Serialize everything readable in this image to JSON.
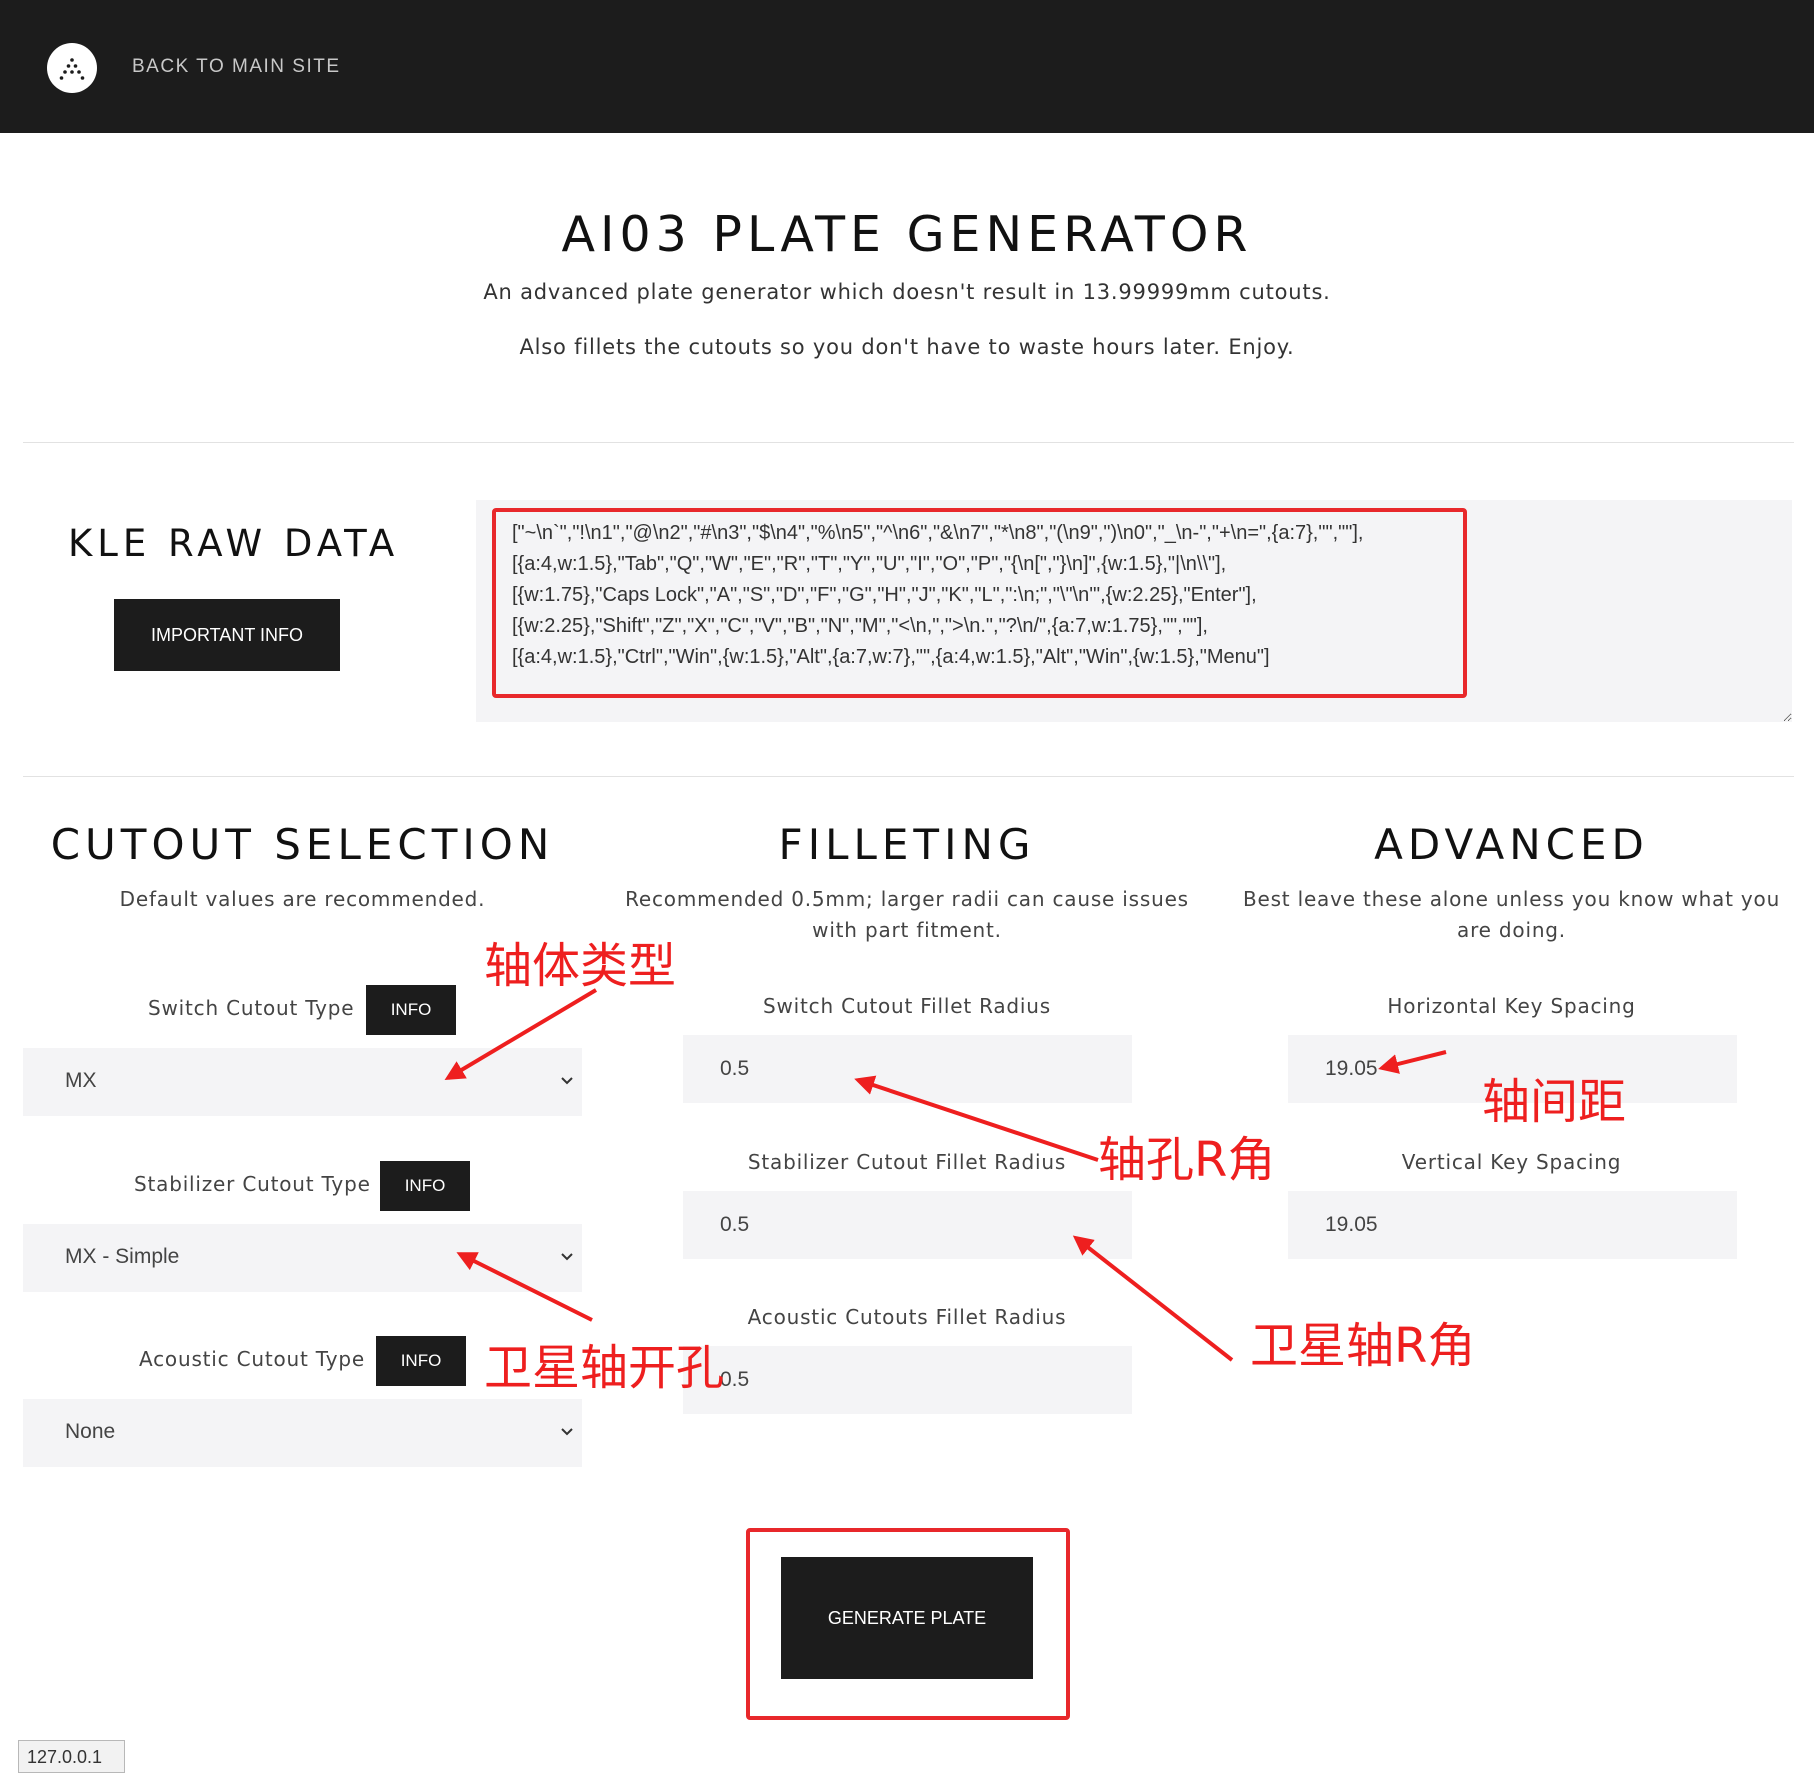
{
  "topbar": {
    "logo_icon": "triangle-dots-logo-icon",
    "back_link": "BACK TO MAIN SITE"
  },
  "hero": {
    "title": "AI03 PLATE GENERATOR",
    "subtitle_1": "An advanced plate generator which doesn't result in 13.99999mm cutouts.",
    "subtitle_2": "Also fillets the cutouts so you don't have to waste hours later. Enjoy."
  },
  "kle": {
    "heading": "KLE RAW DATA",
    "info_button": "IMPORTANT INFO",
    "raw_data": "[\"~\\n`\",\"!\\n1\",\"@\\n2\",\"#\\n3\",\"$\\n4\",\"%\\n5\",\"^\\n6\",\"&\\n7\",\"*\\n8\",\"(\\n9\",\")\\n0\",\"_\\n-\",\"+\\n=\",{a:7},\"\",\"\"],\n[{a:4,w:1.5},\"Tab\",\"Q\",\"W\",\"E\",\"R\",\"T\",\"Y\",\"U\",\"I\",\"O\",\"P\",\"{\\n[\",\"}\\n]\",{w:1.5},\"|\\n\\\\\"],\n[{w:1.75},\"Caps Lock\",\"A\",\"S\",\"D\",\"F\",\"G\",\"H\",\"J\",\"K\",\"L\",\":\\n;\",\"\\\"\\n'\",{w:2.25},\"Enter\"],\n[{w:2.25},\"Shift\",\"Z\",\"X\",\"C\",\"V\",\"B\",\"N\",\"M\",\"<\\n,\",\">\\n.\",\"?\\n/\",{a:7,w:1.75},\"\",\"\"],\n[{a:4,w:1.5},\"Ctrl\",\"Win\",{w:1.5},\"Alt\",{a:7,w:7},\"\",{a:4,w:1.5},\"Alt\",\"Win\",{w:1.5},\"Menu\"]"
  },
  "cutout": {
    "heading": "CUTOUT SELECTION",
    "description": "Default values are recommended.",
    "switch_label": "Switch Cutout Type",
    "switch_value": "MX",
    "stab_label": "Stabilizer Cutout Type",
    "stab_value": "MX - Simple",
    "acoustic_label": "Acoustic Cutout Type",
    "acoustic_value": "None",
    "info_button": "INFO"
  },
  "filleting": {
    "heading": "FILLETING",
    "description": "Recommended 0.5mm; larger radii can cause issues with part fitment.",
    "switch_label": "Switch Cutout Fillet Radius",
    "switch_value": "0.5",
    "stab_label": "Stabilizer Cutout Fillet Radius",
    "stab_value": "0.5",
    "acoustic_label": "Acoustic Cutouts Fillet Radius",
    "acoustic_value": "0.5"
  },
  "advanced": {
    "heading": "ADVANCED",
    "description": "Best leave these alone unless you know what you are doing.",
    "h_label": "Horizontal Key Spacing",
    "h_value": "19.05",
    "v_label": "Vertical Key Spacing",
    "v_value": "19.05"
  },
  "generate_button": "GENERATE PLATE",
  "status_url": "127.0.0.1",
  "annotations": {
    "switch_type": "轴体类型",
    "key_spacing": "轴间距",
    "switch_fillet": "轴孔R角",
    "stab_fillet": "卫星轴R角",
    "stab_cutout": "卫星轴开孔"
  },
  "colors": {
    "topbar": "#1c1c1c",
    "button": "#1c1c1c",
    "field_bg": "#f4f4f6",
    "annotation_red": "#e8282b"
  }
}
